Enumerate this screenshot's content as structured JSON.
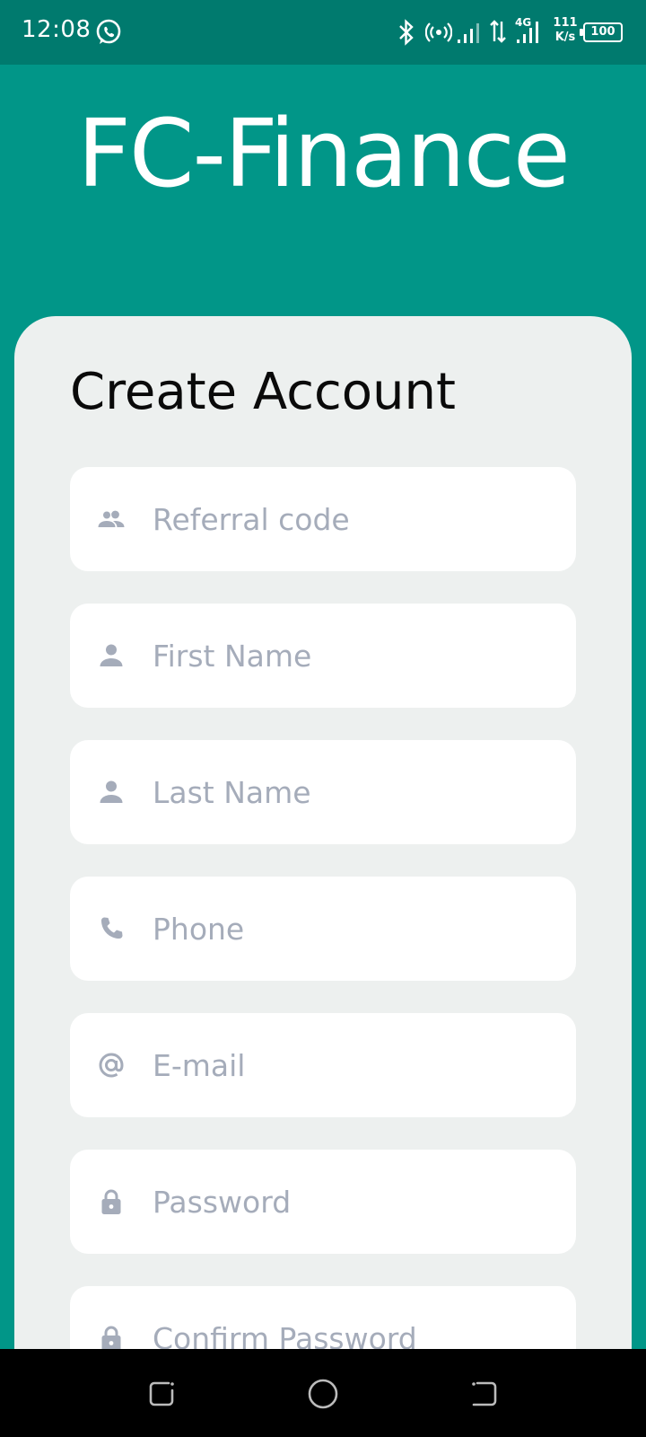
{
  "status_bar": {
    "time": "12:08",
    "network_type": "4G",
    "speed_value": "111",
    "speed_unit": "K/s",
    "battery": "100"
  },
  "brand": {
    "title": "FC-Finance"
  },
  "form": {
    "title": "Create Account",
    "fields": [
      {
        "icon": "group-icon",
        "placeholder": "Referral code"
      },
      {
        "icon": "person-icon",
        "placeholder": "First Name"
      },
      {
        "icon": "person-icon",
        "placeholder": "Last Name"
      },
      {
        "icon": "phone-icon",
        "placeholder": "Phone"
      },
      {
        "icon": "at-icon",
        "placeholder": "E-mail"
      },
      {
        "icon": "lock-icon",
        "placeholder": "Password"
      },
      {
        "icon": "lock-icon",
        "placeholder": "Confirm Password"
      }
    ]
  },
  "colors": {
    "brand_teal": "#019688",
    "status_bar": "#007a6e",
    "card_bg": "#edf0ef",
    "placeholder": "#a5acba",
    "icon": "#a5acba"
  }
}
